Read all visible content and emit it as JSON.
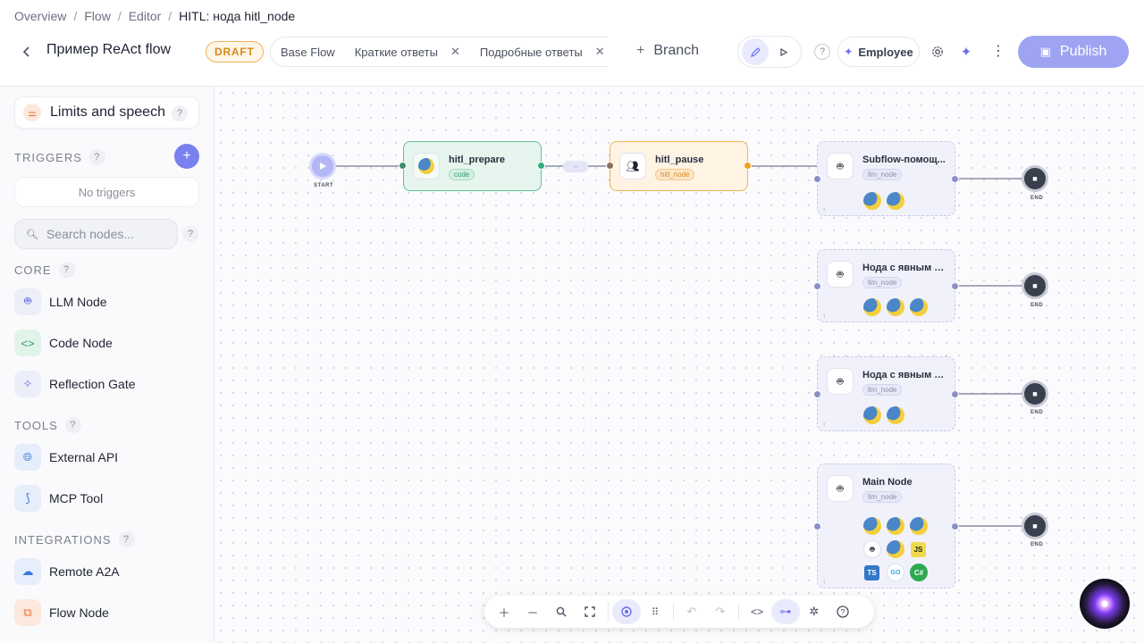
{
  "breadcrumb": {
    "items": [
      "Overview",
      "Flow",
      "Editor"
    ],
    "current": "HITL: нода hitl_node",
    "separator": "/"
  },
  "header": {
    "flow_title": "Пример ReAct flow",
    "status_badge": "DRAFT",
    "tabs": [
      {
        "label": "Base Flow",
        "closable": false
      },
      {
        "label": "Краткие ответы",
        "closable": true
      },
      {
        "label": "Подробные ответы",
        "closable": true
      }
    ],
    "branch_label": "Branch",
    "help_label": "?",
    "employee_label": "Employee",
    "publish_label": "Publish",
    "accent_color": "#9ea4f2"
  },
  "sidebar": {
    "limits_label": "Limits and speech",
    "triggers_title": "TRIGGERS",
    "no_triggers": "No triggers",
    "search_placeholder": "Search nodes...",
    "sections": [
      {
        "title": "CORE",
        "items": [
          {
            "label": "LLM Node",
            "icon": "robot-icon"
          },
          {
            "label": "Code Node",
            "icon": "code-icon"
          },
          {
            "label": "Reflection Gate",
            "icon": "sparkle-icon"
          }
        ]
      },
      {
        "title": "TOOLS",
        "items": [
          {
            "label": "External API",
            "icon": "globe-icon"
          },
          {
            "label": "MCP Tool",
            "icon": "mcp-icon"
          }
        ]
      },
      {
        "title": "INTEGRATIONS",
        "items": [
          {
            "label": "Remote A2A",
            "icon": "cloud-icon"
          },
          {
            "label": "Flow Node",
            "icon": "flow-icon"
          }
        ]
      }
    ]
  },
  "canvas": {
    "start_label": "START",
    "end_label": "END",
    "edge_chip": "–",
    "nodes": [
      {
        "title": "hitl_prepare",
        "tag": "code",
        "kind": "code"
      },
      {
        "title": "hitl_pause",
        "tag": "hitl_node",
        "kind": "hitl"
      },
      {
        "title": "Subflow-помощ...",
        "tag": "llm_node",
        "kind": "llm",
        "tools": [
          "python",
          "python"
        ]
      },
      {
        "title": "Нода с явным за...",
        "tag": "llm_node",
        "kind": "llm",
        "tools": [
          "python",
          "python",
          "python"
        ]
      },
      {
        "title": "Нода с явным за...",
        "tag": "llm_node",
        "kind": "llm",
        "tools": [
          "python",
          "python"
        ]
      },
      {
        "title": "Main Node",
        "tag": "llm_node",
        "kind": "llm",
        "tools": [
          "python",
          "python",
          "python",
          "robot",
          "python",
          "JS",
          "TS",
          "GO",
          "C#"
        ]
      }
    ]
  },
  "toolbar": {
    "buttons": [
      "zoom-in",
      "zoom-out",
      "search",
      "fit-view",
      "focus",
      "grid",
      "undo",
      "redo",
      "code",
      "layout",
      "network",
      "help"
    ]
  }
}
